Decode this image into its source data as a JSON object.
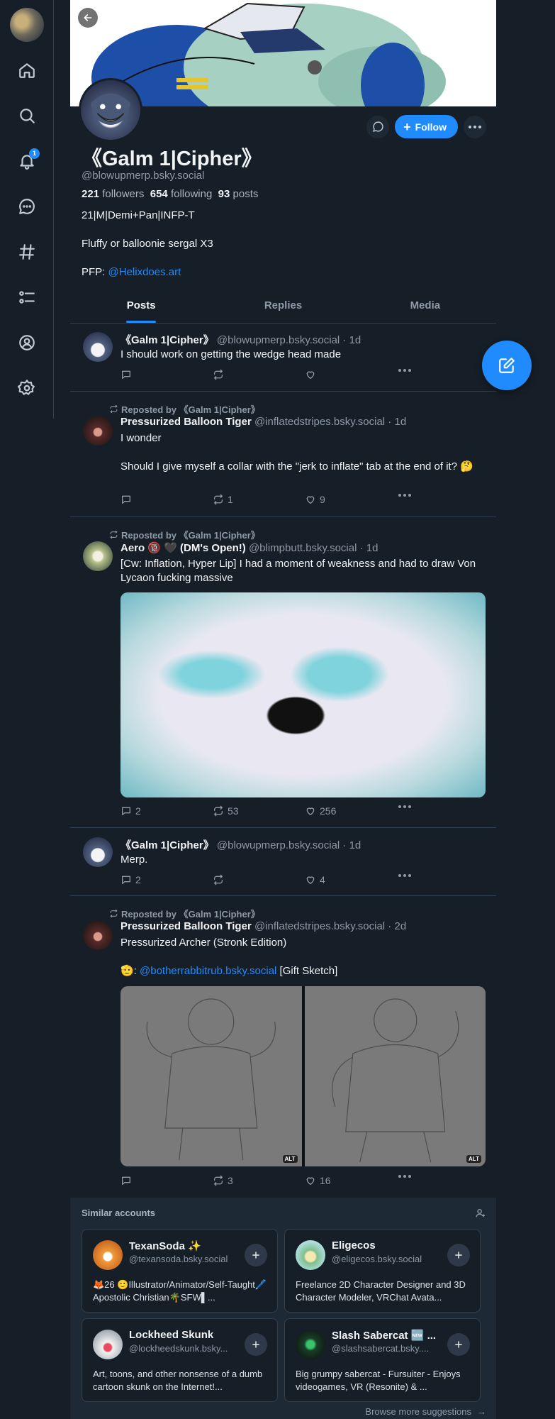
{
  "rail": {
    "items": [
      "home",
      "search",
      "notifications",
      "chat",
      "feeds",
      "lists",
      "profile",
      "settings"
    ],
    "notification_count": "1"
  },
  "profile": {
    "display_name": "《Galm 1|Cipher》",
    "handle": "@blowupmerp.bsky.social",
    "followers_count": "221",
    "followers_label": "followers",
    "following_count": "654",
    "following_label": "following",
    "posts_count": "93",
    "posts_label": "posts",
    "bio_line1": "21|M|Demi+Pan|INFP-T",
    "bio_line2": "Fluffy or balloonie sergal X3",
    "bio_pfp_label": "PFP: ",
    "bio_pfp_link": "@Helixdoes.art",
    "follow_label": "Follow"
  },
  "tabs": [
    "Posts",
    "Replies",
    "Media"
  ],
  "posts": [
    {
      "name": "《Galm 1|Cipher》",
      "handle": "@blowupmerp.bsky.social · 1d",
      "text": "I should work on getting the wedge head made",
      "replies": "",
      "reposts": "",
      "likes": ""
    },
    {
      "repost_by": "Reposted by 《Galm 1|Cipher》",
      "name": "Pressurized Balloon Tiger",
      "handle": "@inflatedstripes.bsky.social · 1d",
      "text1": "I wonder",
      "text2": "Should I give myself a collar with the \"jerk to inflate\" tab at the end of it? 🤔",
      "replies": "",
      "reposts": "1",
      "likes": "9"
    },
    {
      "repost_by": "Reposted by 《Galm 1|Cipher》",
      "name": "Aero 🔞 🖤 (DM's Open!)",
      "handle": "@blimpbutt.bsky.social · 1d",
      "text": "[Cw: Inflation, Hyper Lip] I had a moment of weakness and had to draw Von Lycaon fucking massive",
      "replies": "2",
      "reposts": "53",
      "likes": "256"
    },
    {
      "name": "《Galm 1|Cipher》",
      "handle": "@blowupmerp.bsky.social · 1d",
      "text": "Merp.",
      "replies": "2",
      "reposts": "",
      "likes": "4"
    },
    {
      "repost_by": "Reposted by 《Galm 1|Cipher》",
      "name": "Pressurized Balloon Tiger",
      "handle": "@inflatedstripes.bsky.social · 2d",
      "text1": "Pressurized Archer (Stronk Edition)",
      "text2_prefix": "🫡: ",
      "text2_link": "@botherrabbitrub.bsky.social",
      "text2_suffix": " [Gift Sketch]",
      "alt_label": "ALT",
      "replies": "",
      "reposts": "3",
      "likes": "16"
    }
  ],
  "similar": {
    "title": "Similar accounts",
    "browse": "Browse more suggestions",
    "accounts": [
      {
        "name": "TexanSoda ✨",
        "handle": "@texansoda.bsky.social",
        "bio": "🦊26 🙂Illustrator/Animator/Self-Taught🖊️Apostolic Christian🌴SFW▌..."
      },
      {
        "name": "Eligecos",
        "handle": "@eligecos.bsky.social",
        "bio": "Freelance 2D Character Designer and 3D Character Modeler, VRChat Avata..."
      },
      {
        "name": "Lockheed Skunk",
        "handle": "@lockheedskunk.bsky...",
        "bio": "Art, toons, and other nonsense of a dumb cartoon skunk on the Internet!..."
      },
      {
        "name": "Slash Sabercat 🆕 ...",
        "handle": "@slashsabercat.bsky....",
        "bio": "Big grumpy sabercat - Fursuiter - Enjoys videogames, VR (Resonite) & ..."
      }
    ]
  },
  "colors": {
    "accent": "#208bfe",
    "background": "#161e27",
    "border": "#2e4052"
  }
}
